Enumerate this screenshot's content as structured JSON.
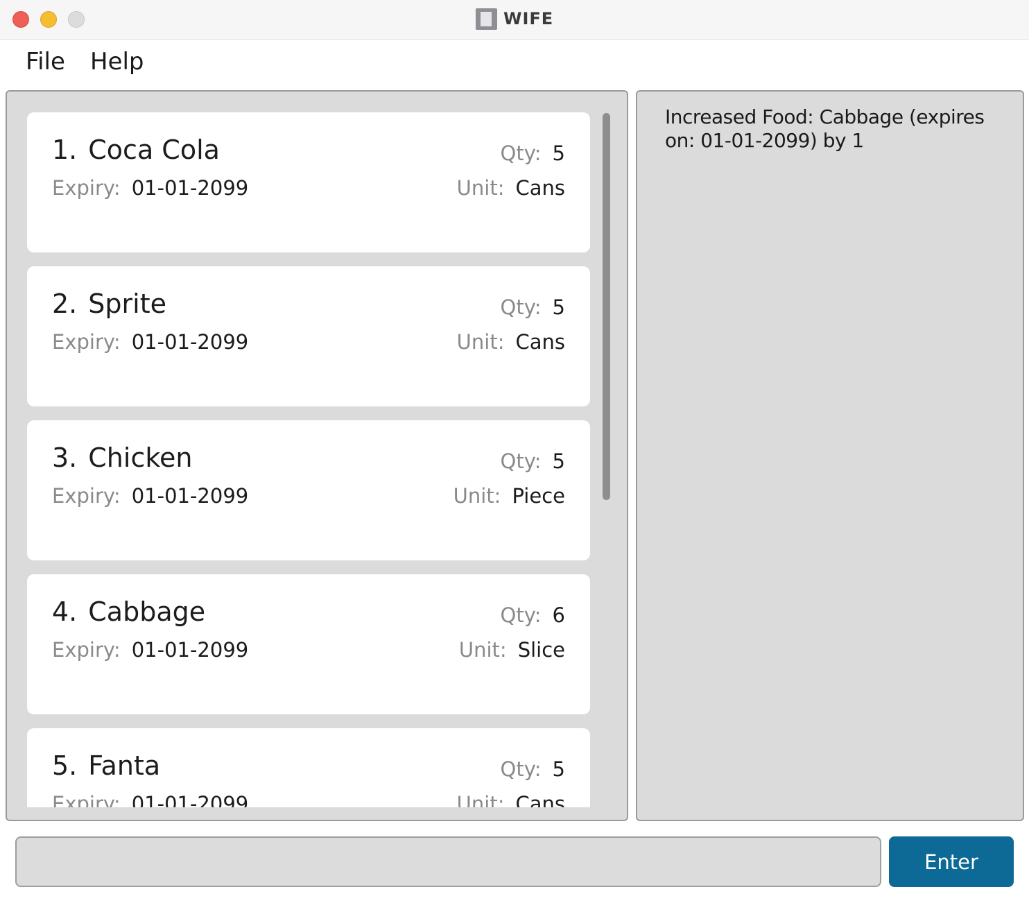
{
  "window": {
    "title": "WIFE"
  },
  "menu": {
    "items": [
      {
        "label": "File"
      },
      {
        "label": "Help"
      }
    ]
  },
  "food_list": {
    "items": [
      {
        "index": "1.",
        "name": "Coca Cola",
        "expiry_label": "Expiry:",
        "expiry": "01-01-2099",
        "qty_label": "Qty:",
        "qty": "5",
        "unit_label": "Unit:",
        "unit": "Cans"
      },
      {
        "index": "2.",
        "name": "Sprite",
        "expiry_label": "Expiry:",
        "expiry": "01-01-2099",
        "qty_label": "Qty:",
        "qty": "5",
        "unit_label": "Unit:",
        "unit": "Cans"
      },
      {
        "index": "3.",
        "name": "Chicken",
        "expiry_label": "Expiry:",
        "expiry": "01-01-2099",
        "qty_label": "Qty:",
        "qty": "5",
        "unit_label": "Unit:",
        "unit": "Piece"
      },
      {
        "index": "4.",
        "name": "Cabbage",
        "expiry_label": "Expiry:",
        "expiry": "01-01-2099",
        "qty_label": "Qty:",
        "qty": "6",
        "unit_label": "Unit:",
        "unit": "Slice"
      },
      {
        "index": "5.",
        "name": "Fanta",
        "expiry_label": "Expiry:",
        "expiry": "01-01-2099",
        "qty_label": "Qty:",
        "qty": "5",
        "unit_label": "Unit:",
        "unit": "Cans"
      }
    ]
  },
  "result_display": {
    "text": "Increased Food: Cabbage (expires on: 01-01-2099) by 1"
  },
  "command_box": {
    "value": "",
    "placeholder": "",
    "enter_label": "Enter"
  },
  "colors": {
    "accent": "#0d6995",
    "panel_bg": "#dbdbdb",
    "card_bg": "#ffffff",
    "close": "#ee5f57",
    "minimize": "#f5bd30",
    "maximize": "#dcdcdc"
  }
}
